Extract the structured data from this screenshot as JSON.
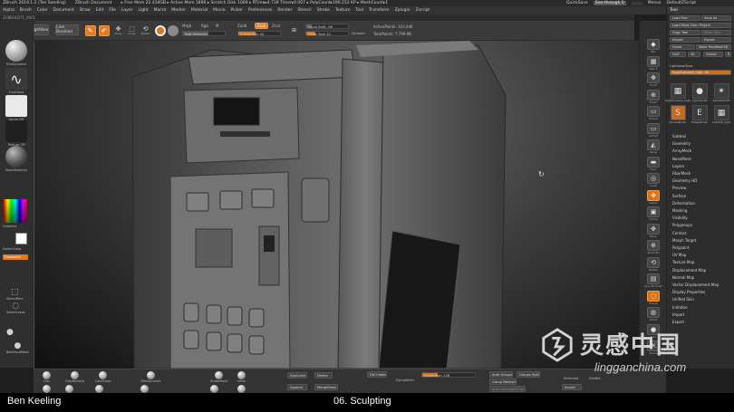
{
  "titlebar": {
    "items": [
      "ZBrush 2019.1.2 (Ten Seeding)",
      "ZBrush Document",
      "▸ Free Mem 22.434GB ▸ Active Mem 1896 ▸ Scratch Disk 1069 ▸ RTime▸4.739 Timer▸0.007 ▸ PolyCount▸190.252 KP ▸ MeshCount▸1"
    ],
    "quicksave": "QuickSave",
    "see_through": "See-through 0",
    "menus_label": "Menus",
    "default_script": "DefaultZScript"
  },
  "menubar": [
    "Alpha",
    "Brush",
    "Color",
    "Document",
    "Draw",
    "Edit",
    "File",
    "Layer",
    "Light",
    "Macro",
    "Marker",
    "Material",
    "Movie",
    "Picker",
    "Preferences",
    "Render",
    "Stencil",
    "Stroke",
    "Texture",
    "Tool",
    "Transform",
    "Zplugin",
    "Zscript"
  ],
  "pathbar": "ZUIBUILDT1_0001",
  "toolbar": {
    "home_page": "Home Page",
    "lightbox": "LightBox",
    "live_boolean": "Live Boolean",
    "edit": "Edit",
    "draw": "Draw",
    "move": "Move",
    "scale": "Scale",
    "rotate": "Rotate",
    "mrgb": "Mrgb",
    "rgb": "Rgb",
    "m": "M",
    "rgb_intensity": "Rgb Intensity",
    "zadd": "Zadd",
    "zsub": "Zsub",
    "zcut": "Zcut",
    "z_intensity": "Z Intensity 42",
    "focal_shift": "Focal Shift -96",
    "draw_size": "Draw Size 12",
    "dynamic": "Dynamic",
    "active_points": "ActivePoints: 103,446",
    "total_points": "TotalPoints: 7.799 Mil"
  },
  "leftshelf": {
    "standard": "TrimDynamic",
    "stroke": "FreeHand",
    "alpha": "Alpha Off",
    "texture": "Texture Off",
    "material": "BasicMaterial",
    "gradient": "Gradient",
    "switch_color": "SwitchColor",
    "alternate": "Alternate",
    "material_pill": "Flowsmith",
    "select_rect": "SelectRect",
    "select_lasso": "SelectLasso",
    "backface": "BackfaceMask"
  },
  "rightshelf": [
    "Bpr",
    "SPix 3",
    "Scroll",
    "Zoom",
    "Actual",
    "AAHalf",
    "Persp",
    "Floor",
    "Local",
    "Gizmo",
    "Frame",
    "Move",
    "Zoom3D",
    "Rotate",
    "Line Fill PolyF",
    "Transp",
    "Ghost",
    "Solo",
    "Xpose"
  ],
  "toolpalette": {
    "header": "Tool",
    "buttons": [
      {
        "label": "Load Tool",
        "style": "normal"
      },
      {
        "label": "Save As",
        "style": "normal"
      },
      {
        "label": "Load Tools From Project",
        "style": "normal"
      },
      {
        "label": "Copy Tool",
        "style": "normal"
      },
      {
        "label": "Paste Tool",
        "style": "dim"
      },
      {
        "label": "Import",
        "style": "normal"
      },
      {
        "label": "Export",
        "style": "normal"
      },
      {
        "label": "Clone",
        "style": "normal"
      },
      {
        "label": "Make PolyMesh3D",
        "style": "normal"
      },
      {
        "label": "GoZ",
        "style": "normal"
      },
      {
        "label": "All",
        "style": "normal"
      },
      {
        "label": "Visible",
        "style": "normal"
      },
      {
        "label": "R",
        "style": "normal"
      }
    ],
    "lightbox_tools": "Lightbox▸Tools",
    "current_tool": "RightConsole_high. 48",
    "subtools": [
      {
        "label": "RightConsole_high",
        "icon": "▦",
        "style": "normal"
      },
      {
        "label": "Cylinder3D",
        "icon": "●",
        "style": "normal"
      },
      {
        "label": "PolyMesh3D",
        "icon": "✶",
        "style": "normal"
      },
      {
        "label": "SimpleBrush",
        "icon": "S",
        "style": "orange"
      },
      {
        "label": "EraserBrush",
        "icon": "E",
        "style": "normal"
      },
      {
        "label": "SubdHP_right",
        "icon": "▦",
        "style": "normal"
      }
    ],
    "menu": [
      "Subtool",
      "Geometry",
      "ArrayMesh",
      "NanoMesh",
      "Layers",
      "FiberMesh",
      "Geometry HD",
      "Preview",
      "Surface",
      "Deformation",
      "Masking",
      "Visibility",
      "Polygroups",
      "Contact",
      "Morph Target",
      "Polypaint",
      "UV Map",
      "Texture Map",
      "Displacement Map",
      "Normal Map",
      "Vector Displacement Map",
      "Display Properties",
      "Unified Skin",
      "Initialize",
      "Import",
      "Export"
    ]
  },
  "bottomshelf": {
    "brushes": [
      "Clay",
      "ClayBuildup",
      "ClayTubes",
      "TrimDynamic",
      "SnakeHook",
      "Inflat",
      "Move",
      "Pinch",
      "DamStandard",
      "hPolish",
      "Standard",
      "Slash3"
    ],
    "duplicate": "Duplicate",
    "delete": "Delete",
    "append": "Append",
    "merge_down": "MergeDown",
    "del_hidden": "Del Hidden",
    "dynamesh": "DynaMesh",
    "resolution": "Resolution 128",
    "auto_groups": "Auto Groups",
    "groups_split": "Groups Split",
    "group_masked": "Group Masked",
    "split_unmasked": "Split Unmasked Points",
    "selected": "Selected",
    "visible": "Visible",
    "import": "Import"
  },
  "caption": {
    "author": "Ben Keeling",
    "chapter": "06. Sculpting"
  },
  "watermark": {
    "chinese": "灵感中国",
    "url": "lingganchina.com"
  },
  "colors": {
    "accent": "#e27c22",
    "panel": "#2f2f2f",
    "viewport_center": "#6b6b6b",
    "caption_bg": "#000000"
  }
}
